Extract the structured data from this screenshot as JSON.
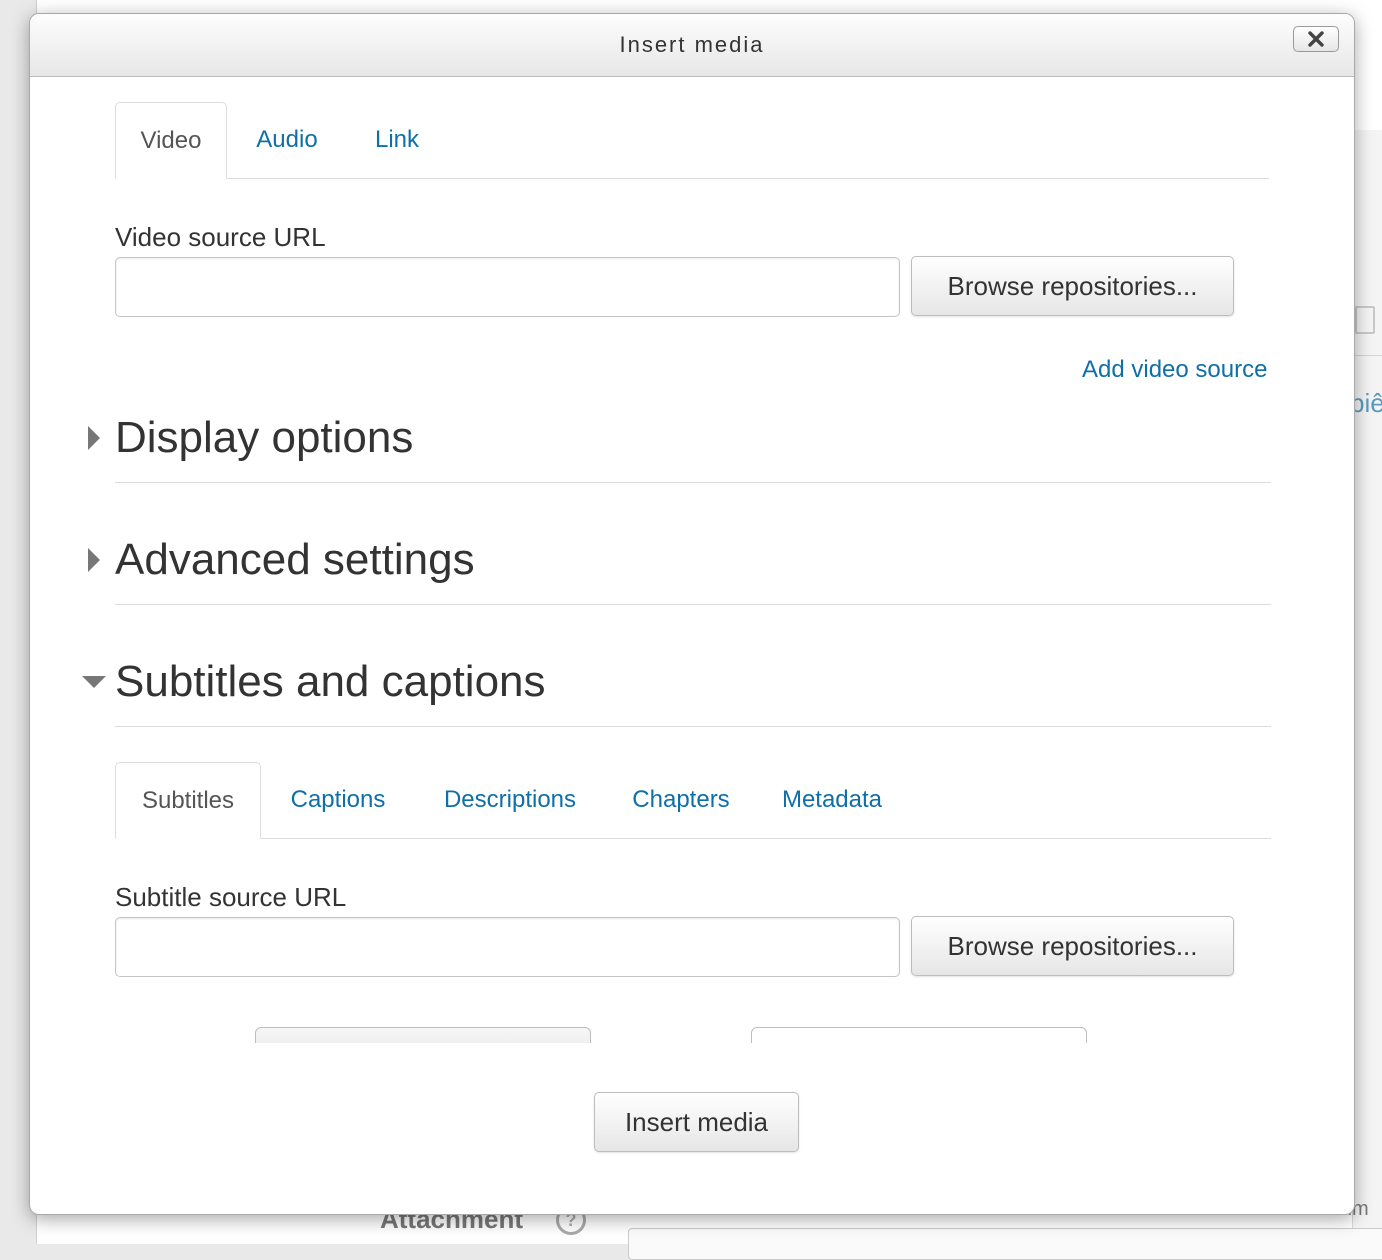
{
  "dialog": {
    "title": "Insert media",
    "close_icon": "close-x-icon"
  },
  "media_tabs": [
    {
      "label": "Video",
      "active": true
    },
    {
      "label": "Audio",
      "active": false
    },
    {
      "label": "Link",
      "active": false
    }
  ],
  "video_source": {
    "label": "Video source URL",
    "value": "",
    "browse_label": "Browse repositories...",
    "add_source_label": "Add video source"
  },
  "sections": {
    "display_options": {
      "title": "Display options",
      "expanded": false
    },
    "advanced_settings": {
      "title": "Advanced settings",
      "expanded": false
    },
    "subtitles_captions": {
      "title": "Subtitles and captions",
      "expanded": true
    }
  },
  "track_tabs": [
    {
      "label": "Subtitles",
      "active": true
    },
    {
      "label": "Captions",
      "active": false
    },
    {
      "label": "Descriptions",
      "active": false
    },
    {
      "label": "Chapters",
      "active": false
    },
    {
      "label": "Metadata",
      "active": false
    }
  ],
  "subtitle_source": {
    "label": "Subtitle source URL",
    "value": "",
    "browse_label": "Browse repositories..."
  },
  "footer": {
    "insert_label": "Insert media"
  },
  "background": {
    "attachment_label": "Attachment",
    "help_glyph": "?",
    "maximum_label": "Maximum",
    "partial_text": "piê"
  },
  "colors": {
    "link": "#0f6fa8",
    "text": "#333333",
    "border": "#dddddd"
  }
}
